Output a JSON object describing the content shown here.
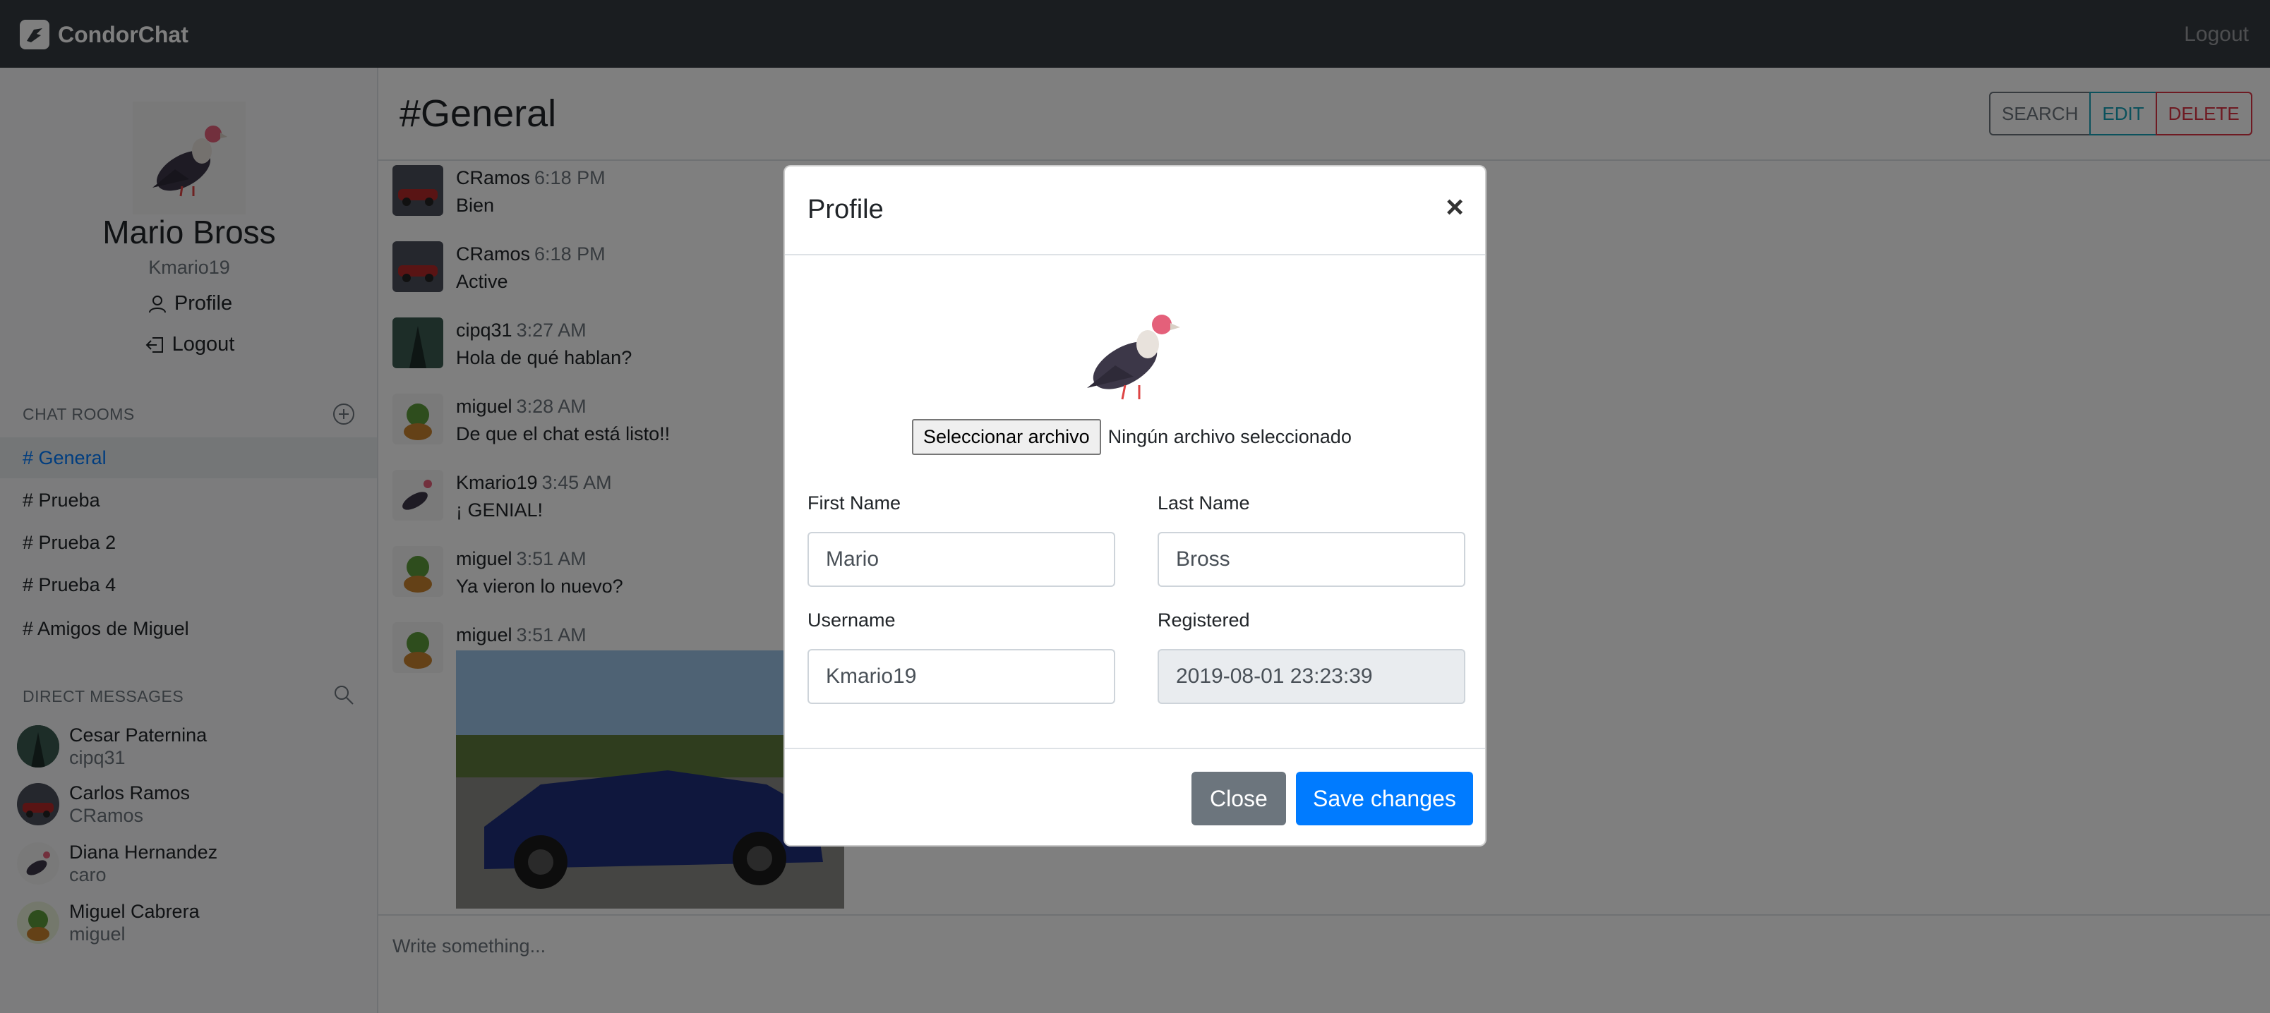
{
  "navbar": {
    "brand": "CondorChat",
    "logout": "Logout"
  },
  "sidebar": {
    "name": "Mario Bross",
    "username": "Kmario19",
    "profile_link": "Profile",
    "logout_link": "Logout",
    "rooms_heading": "CHAT ROOMS",
    "rooms": [
      "# General",
      "# Prueba",
      "# Prueba 2",
      "# Prueba 4",
      "# Amigos de Miguel"
    ],
    "dm_heading": "DIRECT MESSAGES",
    "dms": [
      {
        "name": "Cesar Paternina",
        "username": "cipq31"
      },
      {
        "name": "Carlos Ramos",
        "username": "CRamos"
      },
      {
        "name": "Diana Hernandez",
        "username": "caro"
      },
      {
        "name": "Miguel Cabrera",
        "username": "miguel"
      }
    ]
  },
  "main": {
    "title": "#General",
    "buttons": {
      "search": "SEARCH",
      "edit": "EDIT",
      "delete": "DELETE"
    },
    "messages": [
      {
        "user": "CRamos",
        "time": "6:18 PM",
        "text": "Bien"
      },
      {
        "user": "CRamos",
        "time": "6:18 PM",
        "text": "Active"
      },
      {
        "user": "cipq31",
        "time": "3:27 AM",
        "text": "Hola de qué hablan?"
      },
      {
        "user": "miguel",
        "time": "3:28 AM",
        "text": "De que el chat está listo!!"
      },
      {
        "user": "Kmario19",
        "time": "3:45 AM",
        "text": "¡ GENIAL!"
      },
      {
        "user": "miguel",
        "time": "3:51 AM",
        "text": "Ya vieron lo nuevo?"
      },
      {
        "user": "miguel",
        "time": "3:51 AM",
        "text": ""
      }
    ],
    "composer_placeholder": "Write something..."
  },
  "modal": {
    "title": "Profile",
    "close_symbol": "×",
    "file_button": "Seleccionar archivo",
    "file_status": "Ningún archivo seleccionado",
    "first_name_label": "First Name",
    "first_name": "Mario",
    "last_name_label": "Last Name",
    "last_name": "Bross",
    "username_label": "Username",
    "username": "Kmario19",
    "registered_label": "Registered",
    "registered": "2019-08-01 23:23:39",
    "close_button": "Close",
    "save_button": "Save changes"
  },
  "colors": {
    "primary": "#007bff",
    "navbar": "#343a40",
    "info": "#17a2b8",
    "danger": "#dc3545",
    "secondary": "#6c757d"
  }
}
